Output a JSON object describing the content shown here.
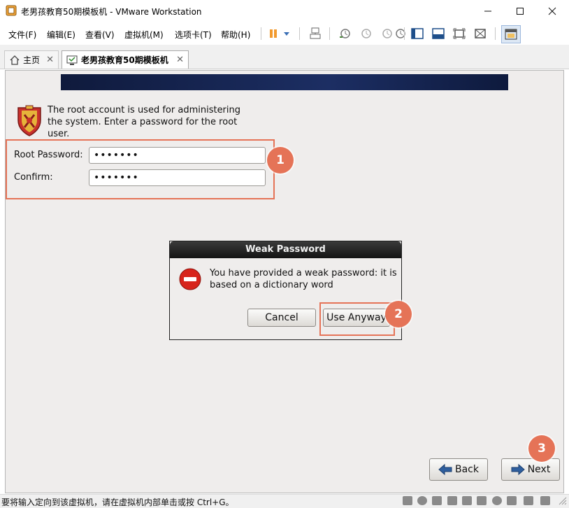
{
  "window": {
    "title": "老男孩教育50期模板机 - VMware Workstation",
    "controls": [
      "minimize",
      "maximize",
      "close"
    ]
  },
  "menu": {
    "items": [
      {
        "label": "文件(F)"
      },
      {
        "label": "编辑(E)"
      },
      {
        "label": "查看(V)"
      },
      {
        "label": "虚拟机(M)"
      },
      {
        "label": "选项卡(T)"
      },
      {
        "label": "帮助(H)"
      }
    ]
  },
  "toolbar": {
    "icons": [
      "pause-icon",
      "dropdown-arrow-icon",
      "send-ctrl-alt-del-icon",
      "snapshot-take-icon",
      "snapshot-revert-icon",
      "snapshot-manager-icon",
      "snapshot-icon",
      "sidebar-toggle-icon",
      "console-view-icon",
      "fullscreen-icon",
      "unity-icon",
      "thumbnail-view-icon"
    ]
  },
  "tabs": [
    {
      "label": "主页",
      "icon": "home-icon",
      "active": false
    },
    {
      "label": "老男孩教育50期模板机",
      "icon": "vm-icon",
      "active": true
    }
  ],
  "installer": {
    "intro": "The root account is used for administering the system.  Enter a password for the root user.",
    "root_password_label": "Root Password:",
    "root_password_value": "•••••••",
    "confirm_label": "Confirm:",
    "confirm_value": "•••••••",
    "back_label": "Back",
    "next_label": "Next"
  },
  "dialog": {
    "title": "Weak Password",
    "message": "You have provided a weak password: it is based on a dictionary word",
    "cancel_label": "Cancel",
    "use_anyway_label": "Use Anyway"
  },
  "annotations": {
    "marker_1": "1",
    "marker_2": "2",
    "marker_3": "3",
    "color": "#e57357"
  },
  "statusbar": {
    "text": "要将输入定向到该虚拟机，请在虚拟机内部单击或按 Ctrl+G。"
  },
  "colors": {
    "banner": "#1c2e63",
    "vm_background": "#efedec",
    "dialog_header": "#1a1a1a",
    "error_icon": "#d7241b"
  }
}
